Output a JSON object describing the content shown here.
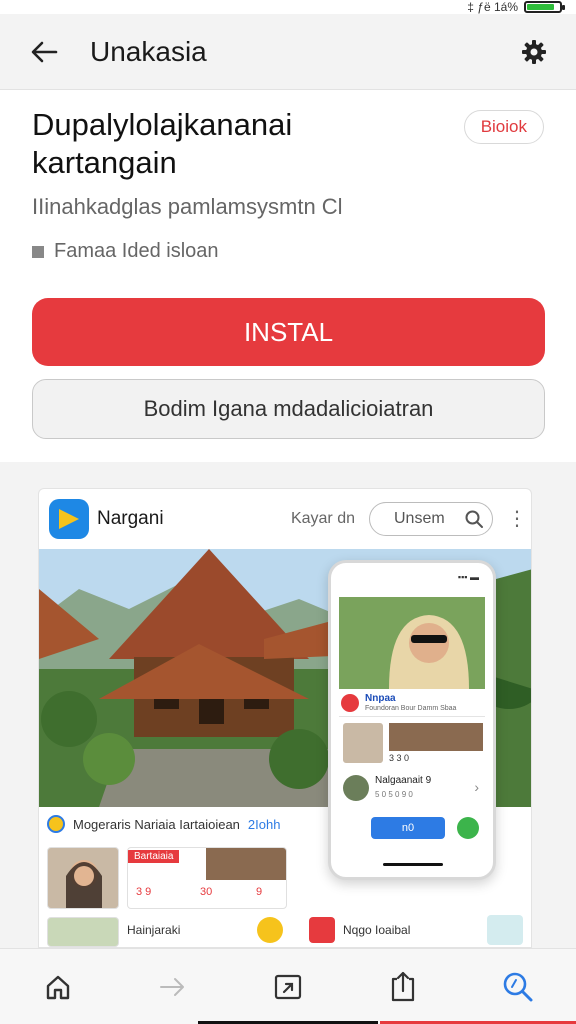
{
  "status_bar": {
    "text": "‡ ƒë 1á%",
    "battery_level": 0.85,
    "battery_color": "#2ebd3a"
  },
  "topbar": {
    "title": "Unakasia",
    "back_icon": "arrow-left-icon",
    "settings_icon": "gear-icon"
  },
  "app": {
    "title": "Dupalylolajkananai kartangain",
    "badge": "Bioiok",
    "subtitle": "IIinahkadglas pamlamsysmtn Cl",
    "meta": "Famaa Ided isloan"
  },
  "actions": {
    "install": "INSTAL",
    "secondary": "Bodim Igana mdadalicioiatran"
  },
  "colors": {
    "accent": "#e63a3e",
    "secondary_border": "#c9c9c9",
    "link_blue": "#2d7be4"
  },
  "preview": {
    "app_name": "Nargani",
    "link": "Kayar dn",
    "search_placeholder": "Unsem",
    "caption": "Mogeraris Nariaia Iartaioiean",
    "caption_accent": "2Iohh",
    "grid_chip": "Bartaiaia",
    "grid_nums": [
      "3 9",
      "30",
      "9"
    ],
    "row_label_1": "Hainjaraki",
    "row_label_2": "Nqgo Ioaibal"
  },
  "phone": {
    "card_title": "Nnpaa",
    "card_sub": "Foundoran Bour Damm Sbaa",
    "stat": "3 3 0",
    "row_title": "Nalgaanait 9",
    "row_sub": "5 0 5 0 9 0",
    "button": "n0"
  },
  "bottom_nav": [
    {
      "name": "home-icon"
    },
    {
      "name": "arrow-right-icon"
    },
    {
      "name": "share-icon"
    },
    {
      "name": "upload-icon"
    },
    {
      "name": "search-icon"
    }
  ]
}
